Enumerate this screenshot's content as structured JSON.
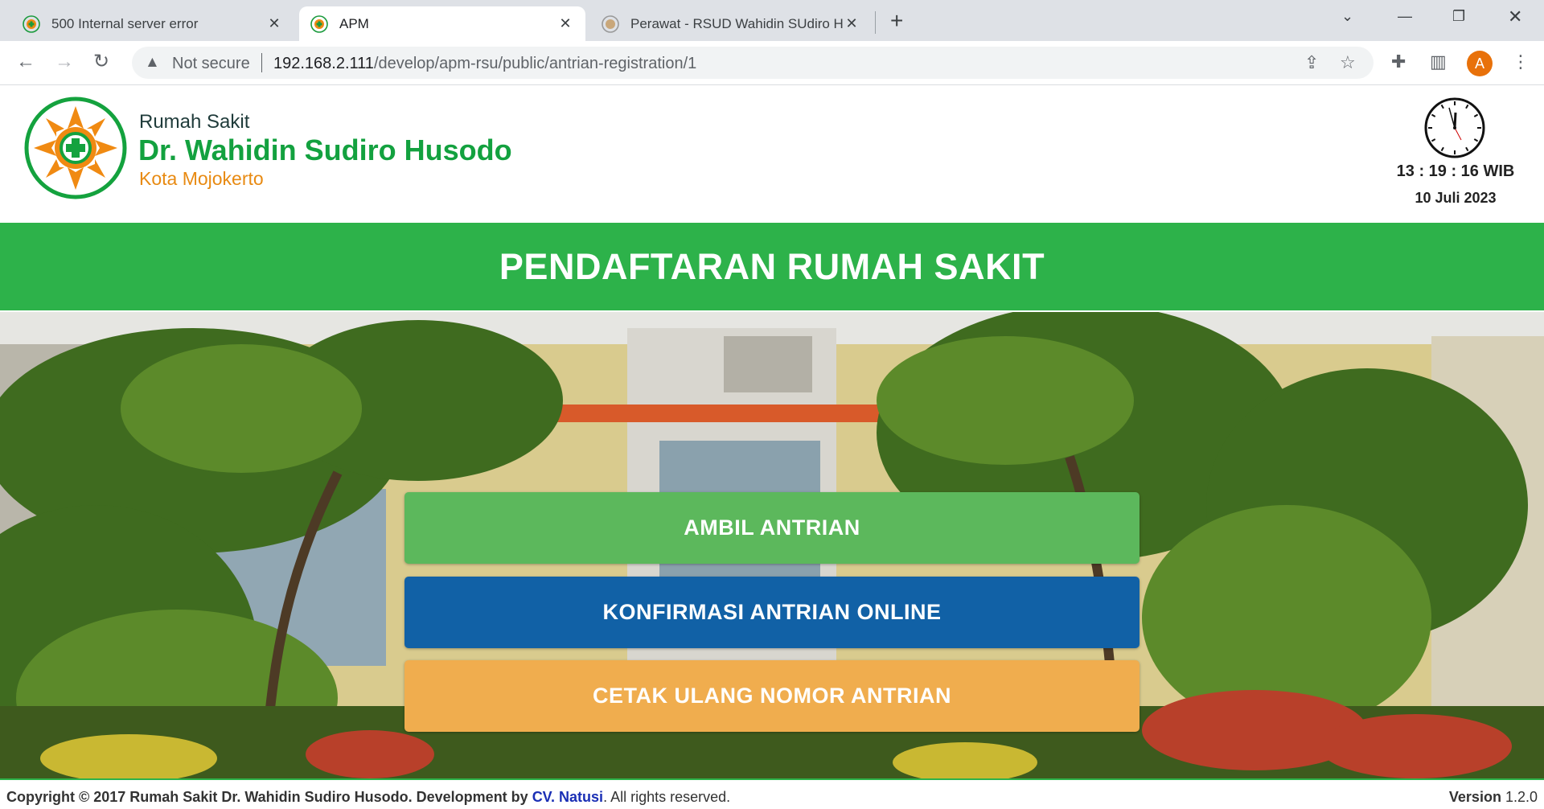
{
  "browser": {
    "tabs": [
      {
        "title": "500 Internal server error",
        "active": false
      },
      {
        "title": "APM",
        "active": true
      },
      {
        "title": "Perawat - RSUD Wahidin SUdiro H",
        "active": false
      }
    ],
    "new_tab": "+",
    "security_label": "Not secure",
    "url_host": "192.168.2.111",
    "url_path": "/develop/apm-rsu/public/antrian-registration/1",
    "avatar_letter": "A",
    "icons": [
      "back-icon",
      "forward-icon",
      "reload-icon",
      "warning-icon",
      "share-icon",
      "star-icon",
      "extensions-icon",
      "sidepanel-icon",
      "menu-icon"
    ]
  },
  "header": {
    "line1": "Rumah Sakit",
    "line2": "Dr. Wahidin Sudiro Husodo",
    "line3": "Kota Mojokerto",
    "time": "13 : 19 : 16 WIB",
    "date": "10 Juli 2023"
  },
  "banner": {
    "title": "PENDAFTARAN RUMAH SAKIT"
  },
  "menu": {
    "ambil": "AMBIL ANTRIAN",
    "konfirmasi": "KONFIRMASI ANTRIAN ONLINE",
    "cetak": "CETAK ULANG NOMOR ANTRIAN"
  },
  "footer": {
    "copyright": "Copyright © 2017 Rumah Sakit Dr. Wahidin Sudiro Husodo. Development by ",
    "developer": "CV. Natusi",
    "rights": ". All rights reserved.",
    "version_label": "Version",
    "version_value": "1.2.0"
  },
  "colors": {
    "brand_green": "#2db24a",
    "button_green": "#5cb85c",
    "button_blue": "#1161a6",
    "button_orange": "#f0ad4e",
    "logo_orange": "#e88a12"
  }
}
